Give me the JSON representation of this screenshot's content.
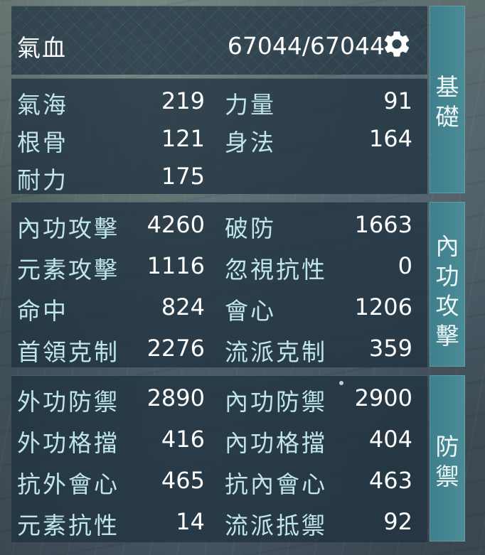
{
  "header": {
    "label": "氣血",
    "value": "67044/67044",
    "settings_icon": "gear-icon"
  },
  "tabs": [
    {
      "lines": [
        "基",
        "礎"
      ]
    },
    {
      "lines": [
        "內",
        "功",
        "攻",
        "擊"
      ]
    },
    {
      "lines": [
        "防",
        "禦"
      ]
    }
  ],
  "basic": {
    "rows": [
      {
        "left_label": "氣海",
        "left_value": "219",
        "right_label": "力量",
        "right_value": "91"
      },
      {
        "left_label": "根骨",
        "left_value": "121",
        "right_label": "身法",
        "right_value": "164"
      },
      {
        "left_label": "耐力",
        "left_value": "175"
      }
    ]
  },
  "attack": {
    "rows": [
      {
        "left_label": "內功攻擊",
        "left_value": "4260",
        "right_label": "破防",
        "right_value": "1663"
      },
      {
        "left_label": "元素攻擊",
        "left_value": "1116",
        "right_label": "忽視抗性",
        "right_value": "0"
      },
      {
        "left_label": "命中",
        "left_value": "824",
        "right_label": "會心",
        "right_value": "1206"
      },
      {
        "left_label": "首領克制",
        "left_value": "2276",
        "right_label": "流派克制",
        "right_value": "359"
      }
    ]
  },
  "defense": {
    "rows": [
      {
        "left_label": "外功防禦",
        "left_value": "2890",
        "right_label": "內功防禦",
        "right_value": "2900"
      },
      {
        "left_label": "外功格擋",
        "left_value": "416",
        "right_label": "內功格擋",
        "right_value": "404"
      },
      {
        "left_label": "抗外會心",
        "left_value": "465",
        "right_label": "抗內會心",
        "right_value": "463"
      },
      {
        "left_label": "元素抗性",
        "left_value": "14",
        "right_label": "流派抵禦",
        "right_value": "92"
      }
    ]
  },
  "colors": {
    "label": "#bfe6ea",
    "value": "#ffffff",
    "tab": "#4c8c97",
    "panel": "#203240"
  }
}
